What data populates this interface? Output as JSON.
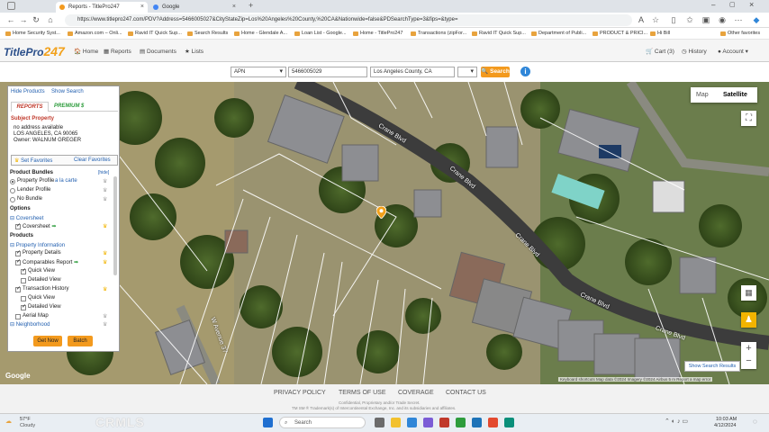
{
  "browser": {
    "tabs": [
      {
        "label": "Reports - TitlePro247",
        "active": true
      },
      {
        "label": "Google",
        "active": false
      }
    ],
    "url": "https://www.titlepro247.com/PDV?Address=5466005027&CityStateZip=Los%20Angeles%20County,%20CA&Nationwide=false&PDSearchType=3&fips=&type=",
    "bookmarks": [
      "Home Security Syst...",
      "Amazon.com – Onli...",
      "Ravid IT Quick Sup...",
      "Search Results",
      "Home - Glendale A...",
      "Loan List - Google...",
      "Home - TitlePro247",
      "Transactions (zipFor...",
      "Ravid IT Quick Sup...",
      "Department of Publi...",
      "PRODUCT & PRICI...",
      "Hi Bill",
      "Other favorites"
    ]
  },
  "app": {
    "logo_text": "TitlePro",
    "logo_num": "247",
    "nav": [
      "Home",
      "Reports",
      "Documents",
      "Lists"
    ],
    "nav_right": [
      "Cart (3)",
      "History",
      "Account"
    ]
  },
  "search": {
    "type": "APN",
    "value": "5466005029",
    "county": "Los Angeles County, CA",
    "button": "Search"
  },
  "panel": {
    "hide_products": "Hide Products",
    "show_search": "Show Search",
    "tab_reports": "REPORTS",
    "tab_premium": "PREMIUM $",
    "subject_title": "Subject Property",
    "address1": "no address available",
    "address2": "LOS ANGELES, CA 90065",
    "owner": "Owner: WALNUM GREGER",
    "set_favorites": "Set Favorites",
    "clear_favorites": "Clear Favorites",
    "bundles_title": "Product Bundles",
    "hide": "[hide]",
    "bundle_options": [
      "Property Profile",
      "Lender Profile",
      "No Bundle"
    ],
    "a_la_carte": "a la carte",
    "options_title": "Options",
    "coversheet_group": "Coversheet",
    "coversheet": "Coversheet",
    "products_title": "Products",
    "property_info": "Property Information",
    "property_details": "Property Details",
    "comparables_report": "Comparables Report",
    "quick_view": "Quick View",
    "detailed_view": "Detailed View",
    "transaction_history": "Transaction History",
    "quick_view2": "Quick View",
    "detailed_view2": "Detailed View",
    "aerial_map": "Aerial Map",
    "neighborhood": "Neighborhood",
    "get_now": "Get Now",
    "batch": "Batch"
  },
  "map": {
    "map_btn": "Map",
    "satellite_btn": "Satellite",
    "street1": "Crane Blvd",
    "street2": "Crane Blvd",
    "street3": "Crane Blvd",
    "street4": "W Avenue 37",
    "show_results": "Show Search Results",
    "google": "Google",
    "attribution": "Keyboard shortcuts   Map data ©2024 Imagery ©2024 Airbus   5 m   Report a map error"
  },
  "footer": {
    "links": [
      "PRIVACY POLICY",
      "TERMS OF USE",
      "COVERAGE",
      "CONTACT US"
    ],
    "line1": "Confidential, Proprietary and/or Trade Secret.",
    "line2": "TM SM ® Trademark(s) of Intercontinental Exchange, Inc. and its subsidiaries and affiliates."
  },
  "taskbar": {
    "temp": "57°F",
    "weather": "Cloudy",
    "search": "Search",
    "time": "10:03 AM",
    "date": "4/12/2024"
  },
  "watermark": "CRMLS"
}
